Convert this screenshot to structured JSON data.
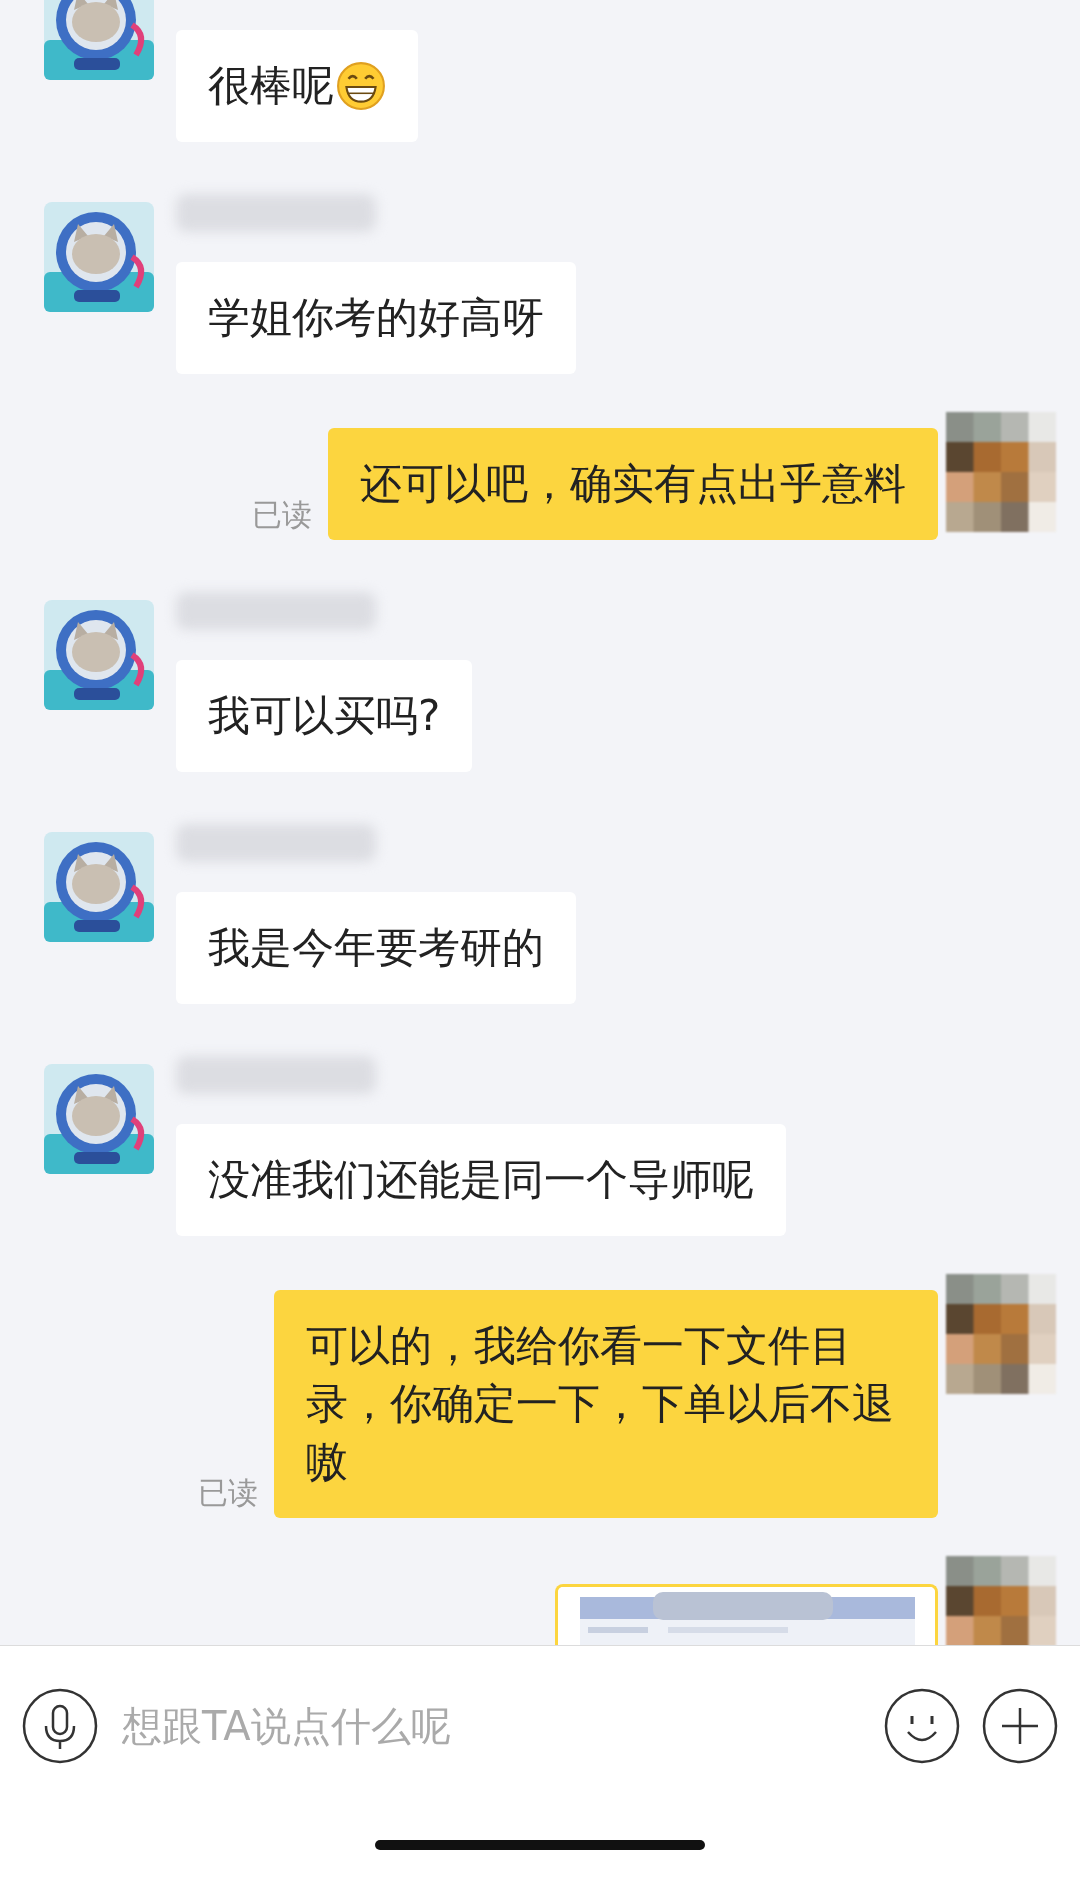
{
  "messages": [
    {
      "kind": "incoming_text",
      "name_blurred": false,
      "text": "很棒呢",
      "emoji": true
    },
    {
      "kind": "incoming_text",
      "name_blurred": true,
      "text": "学姐你考的好高呀",
      "emoji": false
    },
    {
      "kind": "outgoing_text",
      "text": "还可以吧，确实有点出乎意料",
      "read_status": "已读"
    },
    {
      "kind": "incoming_text",
      "name_blurred": true,
      "text": "我可以买吗?",
      "emoji": false
    },
    {
      "kind": "incoming_text",
      "name_blurred": true,
      "text": "我是今年要考研的",
      "emoji": false
    },
    {
      "kind": "incoming_text",
      "name_blurred": true,
      "text": "没准我们还能是同一个导师呢",
      "emoji": false
    },
    {
      "kind": "outgoing_text",
      "text": "可以的，我给你看一下文件目录，你确定一下，下单以后不退嗷",
      "read_status": "已读"
    },
    {
      "kind": "outgoing_image"
    }
  ],
  "input_bar": {
    "placeholder": "想跟TA说点什么呢"
  }
}
